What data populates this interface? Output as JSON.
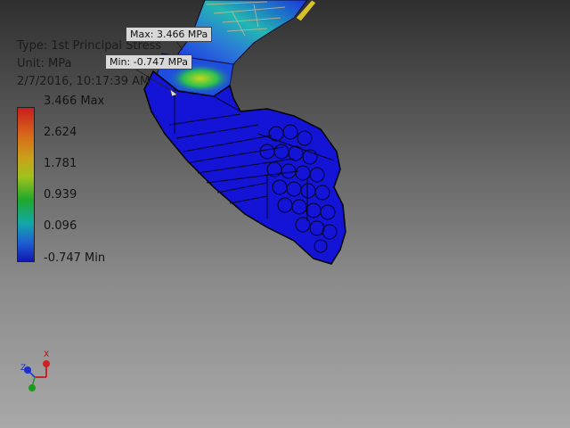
{
  "result": {
    "type_label": "Type: 1st Principal Stress",
    "unit_label": "Unit: MPa",
    "timestamp": "2/7/2016, 10:17:39 AM"
  },
  "legend": {
    "labels": [
      "3.466 Max",
      "2.624",
      "1.781",
      "0.939",
      "0.096",
      "-0.747 Min"
    ],
    "colors": [
      "#c81e1e",
      "#d76a1a",
      "#c9a21a",
      "#9fc21c",
      "#1fa82b",
      "#13a8a8",
      "#1e5ed4",
      "#1018b0"
    ]
  },
  "probes": {
    "max_label": "Max: 3.466 MPa",
    "min_label": "Min: -0.747 MPa"
  },
  "triad": {
    "x_label": "X",
    "z_label": "Z"
  },
  "model": {
    "icons": [
      "stress-mesh-model"
    ],
    "colors": {
      "low": "#1414d6",
      "mid": "#22b86a",
      "high": "#c8d020",
      "outline": "#000000"
    }
  }
}
